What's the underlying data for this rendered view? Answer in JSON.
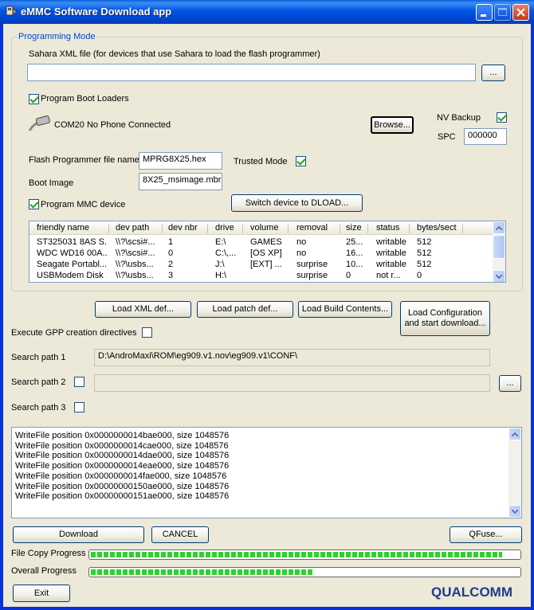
{
  "window": {
    "title": "eMMC Software Download app",
    "icon": "usb-device-icon",
    "controls": {
      "minimize": "minimize-icon",
      "maximize": "maximize-icon",
      "close": "close-icon"
    }
  },
  "programming_mode": {
    "group_label": "Programming Mode",
    "sahara_label": "Sahara XML file (for devices that use Sahara to load the flash programmer)",
    "sahara_value": "",
    "sahara_browse": "...",
    "program_boot_loaders": {
      "label": "Program Boot Loaders",
      "checked": true
    },
    "port_status": "COM20  No Phone Connected",
    "port_icon": "serial-cable-icon",
    "browse_label": "Browse...",
    "nv_backup": {
      "label": "NV Backup",
      "checked": true
    },
    "spc_label": "SPC",
    "spc_value": "000000",
    "flash_programmer_label": "Flash Programmer file name",
    "flash_programmer_value": "MPRG8X25.hex",
    "trusted_mode": {
      "label": "Trusted Mode",
      "checked": true
    },
    "boot_image_label": "Boot Image",
    "boot_image_value": "8X25_msimage.mbr",
    "program_mmc": {
      "label": "Program MMC device",
      "checked": true
    },
    "switch_dload": "Switch device to DLOAD..."
  },
  "device_list": {
    "columns": [
      "friendly name",
      "dev path",
      "dev nbr",
      "drive",
      "volume",
      "removal",
      "size",
      "status",
      "bytes/sect"
    ],
    "rows": [
      [
        "ST325031 8AS S...",
        "\\\\?\\scsi#...",
        "1",
        "E:\\",
        "GAMES",
        "no",
        "25...",
        "writable",
        "512"
      ],
      [
        "WDC WD16 00A...",
        "\\\\?\\scsi#...",
        "0",
        "C:\\,...",
        "[OS XP]",
        "no",
        "16...",
        "writable",
        "512"
      ],
      [
        "Seagate Portabl...",
        "\\\\?\\usbs...",
        "2",
        "J:\\",
        "[EXT] ...",
        "surprise",
        "10...",
        "writable",
        "512"
      ],
      [
        "USBModem Disk ...",
        "\\\\?\\usbs...",
        "3",
        "H:\\",
        "",
        "surprise",
        "0",
        "not r...",
        "0"
      ]
    ]
  },
  "actions": {
    "load_xml": "Load XML def...",
    "load_patch": "Load patch def...",
    "load_build": "Load Build Contents...",
    "load_config": "Load Configuration and start download..."
  },
  "gpp": {
    "label": "Execute GPP creation directives",
    "checked": false
  },
  "search_paths": {
    "path1_label": "Search path 1",
    "path1_value": "D:\\AndroMaxi\\ROM\\eg909.v1.nov\\eg909.v1\\CONF\\",
    "path2_label": "Search path 2",
    "path2_checked": false,
    "path2_value": "",
    "path2_browse": "...",
    "path3_label": "Search path 3",
    "path3_checked": false
  },
  "log": [
    "WriteFile position 0x0000000014bae000, size 1048576",
    "WriteFile position 0x0000000014cae000, size 1048576",
    "WriteFile position 0x0000000014dae000, size 1048576",
    "WriteFile position 0x0000000014eae000, size 1048576",
    "WriteFile position 0x0000000014fae000, size 1048576",
    "WriteFile position 0x00000000150ae000, size 1048576",
    "WriteFile position 0x00000000151ae000, size 1048576"
  ],
  "bottom": {
    "download": "Download",
    "cancel": "CANCEL",
    "qfuse": "QFuse...",
    "file_copy_label": "File Copy Progress",
    "file_copy_progress": 0.96,
    "overall_label": "Overall Progress",
    "overall_progress": 0.52,
    "exit": "Exit",
    "logo": "QUALCOMM"
  },
  "colors": {
    "titlebar": "#0055e5",
    "group_label": "#0046d5",
    "progress": "#2fd12f",
    "logo": "#1f3b8a"
  }
}
